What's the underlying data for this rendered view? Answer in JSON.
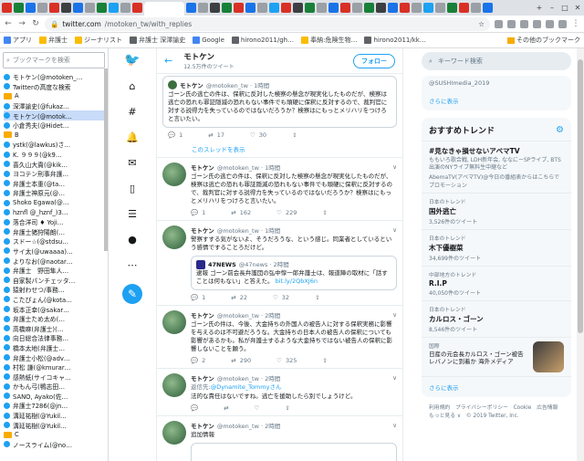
{
  "browser": {
    "url_domain": "twitter.com",
    "url_path": "/motoken_tw/with_replies"
  },
  "bookmarks": {
    "items": [
      "アプリ",
      "弁護士",
      "ジーナリスト",
      "弁護士 深澤諭史",
      "Google",
      "hirono2011/gh…",
      "奉納:危険生物…",
      "hirono2011/kk…"
    ],
    "other": "その他のブックマーク"
  },
  "sidebar": {
    "search_placeholder": "ブックマークを検索",
    "items": [
      {
        "type": "item",
        "label": "モトケン(@motoken_…"
      },
      {
        "type": "item",
        "label": "Twitterの高度な検索"
      },
      {
        "type": "folder",
        "label": "A"
      },
      {
        "type": "item",
        "label": "深澤諭史(@fukaz…"
      },
      {
        "type": "item",
        "label": "モトケン(@motok…",
        "selected": true
      },
      {
        "type": "item",
        "label": "小倉秀夫(@Hidet…"
      },
      {
        "type": "folder",
        "label": "B"
      },
      {
        "type": "item",
        "label": "ystk(@lawkus)さ…"
      },
      {
        "type": "item",
        "label": "K. ９９９(@k9…"
      },
      {
        "type": "item",
        "label": "喜久山大貴(@kik…"
      },
      {
        "type": "item",
        "label": "ヨコテン刑事弁護…"
      },
      {
        "type": "item",
        "label": "弁護士本重(@ta…"
      },
      {
        "type": "item",
        "label": "弁護士神原元(@…"
      },
      {
        "type": "item",
        "label": "Shoko Egawa(@…"
      },
      {
        "type": "item",
        "label": "hznfl @_hznf_)3…"
      },
      {
        "type": "item",
        "label": "落合洋司 ♦ Yoji…"
      },
      {
        "type": "item",
        "label": "弁護士猪狩陽朗(…"
      },
      {
        "type": "item",
        "label": "スドー☆(@stdsu…"
      },
      {
        "type": "item",
        "label": "サイ太(@uwaaaa)…"
      },
      {
        "type": "item",
        "label": "よりなお(@naotar…"
      },
      {
        "type": "item",
        "label": "弁護士　野田隼人…"
      },
      {
        "type": "item",
        "label": "自家製パンチェッタ…"
      },
      {
        "type": "item",
        "label": "猿射わせつ/事務…"
      },
      {
        "type": "item",
        "label": "こたぴょん(@kota…"
      },
      {
        "type": "item",
        "label": "坂本正幸(@sakar…"
      },
      {
        "type": "item",
        "label": "弁護士ため太め(…"
      },
      {
        "type": "item",
        "label": "高橋麻(弁護士)(…"
      },
      {
        "type": "item",
        "label": "向日総合法律事務…"
      },
      {
        "type": "item",
        "label": "橋本太地(弁護士…"
      },
      {
        "type": "item",
        "label": "弁護士小松(@adv…"
      },
      {
        "type": "item",
        "label": "村松 謙(@kmurar…"
      },
      {
        "type": "item",
        "label": "感熱紙(サイコキャ…"
      },
      {
        "type": "item",
        "label": "かもん弓(鴨志田…"
      },
      {
        "type": "item",
        "label": "SANO, Ayako(佐…"
      },
      {
        "type": "item",
        "label": "弁護士7286(@jn…"
      },
      {
        "type": "item",
        "label": "溝延祐樹(@Yukil…"
      },
      {
        "type": "item",
        "label": "溝延祐樹(@Yukil…"
      },
      {
        "type": "folder",
        "label": "C"
      },
      {
        "type": "item",
        "label": "ノースライム(@no…"
      }
    ]
  },
  "profile": {
    "name": "モトケン",
    "tweet_count": "12.5万件のツイート",
    "follow_label": "フォロー"
  },
  "first_tweet": {
    "name": "モトケン",
    "handle": "@motoken_tw · 1時間",
    "text": "ゴーン氏の逃亡の件は、保釈に反対した検察の懸念が現実化したものだが、検察は逃亡の恐れも罪証隠滅の恐れもない事件でも頑硬に保釈に反対するので、裁判官に対する説得力を失っているのではないだろうか？検察はにもっとメリハリをつけろと言いたい。",
    "replies": "1",
    "retweets": "17",
    "likes": "30"
  },
  "show_thread": "このスレッドを表示",
  "tweets": [
    {
      "name": "モトケン",
      "handle": "@motoken_tw · 1時間",
      "text": "ゴーン氏の逃亡の件は、保釈に反対した検察の懸念が現実化したものだが、検察は逃亡の恐れも罪証隠滅の恐れもない事件でも頑硬に保釈に反対するので、裁判官に対する説得力を失っているのではないだろうか？検察はにもっとメリハリをつけろと言いたい。",
      "replies": "1",
      "retweets": "162",
      "likes": "229"
    },
    {
      "name": "モトケン",
      "handle": "@motoken_tw · 1時間",
      "text": "警察すする気がないよ、そうだろうな、という感じ。同業者としているという感情ですることろだけど。",
      "quote": {
        "name": "47NEWS",
        "handle": "@47news · 2時間",
        "text": "逮報 ゴーン前会長弁護団の弘中惇一郎弁護士は、報道陣の取材に「話すことは何もない」と答えた。",
        "link": "bit.ly/2QbXJ6n"
      },
      "replies": "1",
      "retweets": "22",
      "likes": "32"
    },
    {
      "name": "モトケン",
      "handle": "@motoken_tw · 2時間",
      "text": "ゴーン氏の件は、今後、大金持ちの外国人の被告人に対する保釈実務に影響を与えるのは不可避だろうな。大金持ちの日本人の被告人の保釈についても影響があるかも。私が弁護士するような大金持ちではない被告人の保釈に影響しないことを願う。",
      "replies": "2",
      "retweets": "290",
      "likes": "325"
    },
    {
      "name": "モトケン",
      "handle": "@motoken_tw · 2時間",
      "reply_to_label": "返信先:",
      "reply_to_link": "@Dynamite_Tommyさん",
      "text": "法的な責任はないですね。逃亡を援助したら別でしょうけど。",
      "replies": "",
      "retweets": "",
      "likes": ""
    },
    {
      "name": "モトケン",
      "handle": "@motoken_tw · 2時間",
      "text": "追加情報",
      "replies": "",
      "retweets": "",
      "likes": ""
    }
  ],
  "right": {
    "search_placeholder": "キーワード検索",
    "top_small": "@SUSHImedia_2019",
    "show_more": "さらに表示",
    "trends_title": "おすすめトレンド",
    "trends": [
      {
        "context": "",
        "title": "#見なきゃ損せないアベマTV",
        "desc": "ももいろ歌合戦, LDH新年会, ななにーSPライブ, BTS出演のNYライブ無料生中継など",
        "count": "AbemaTV(アベマTV)@今日の番組表からはこちらでプロモーション"
      },
      {
        "context": "日本のトレンド",
        "title": "国外逃亡",
        "desc": "",
        "count": "3,526件のツイート"
      },
      {
        "context": "日本のトレンド",
        "title": "木下優樹菜",
        "desc": "",
        "count": "34,699件のツイート"
      },
      {
        "context": "中部地方のトレンド",
        "title": "R.I.P",
        "desc": "",
        "count": "40,050件のツイート"
      },
      {
        "context": "日本のトレンド",
        "title": "カルロス・ゴーン",
        "desc": "",
        "count": "8,546件のツイート"
      },
      {
        "context": "国際",
        "title": "",
        "desc": "日産の元会長カルロス・ゴーン被告 レバノンに到着か 海外メディア",
        "count": ""
      }
    ],
    "trends_more": "さらに表示",
    "footer": "利用規約　プライバシーポリシー　Cookie　広告情報　もっと見る ∨　© 2019 Twitter, Inc."
  }
}
